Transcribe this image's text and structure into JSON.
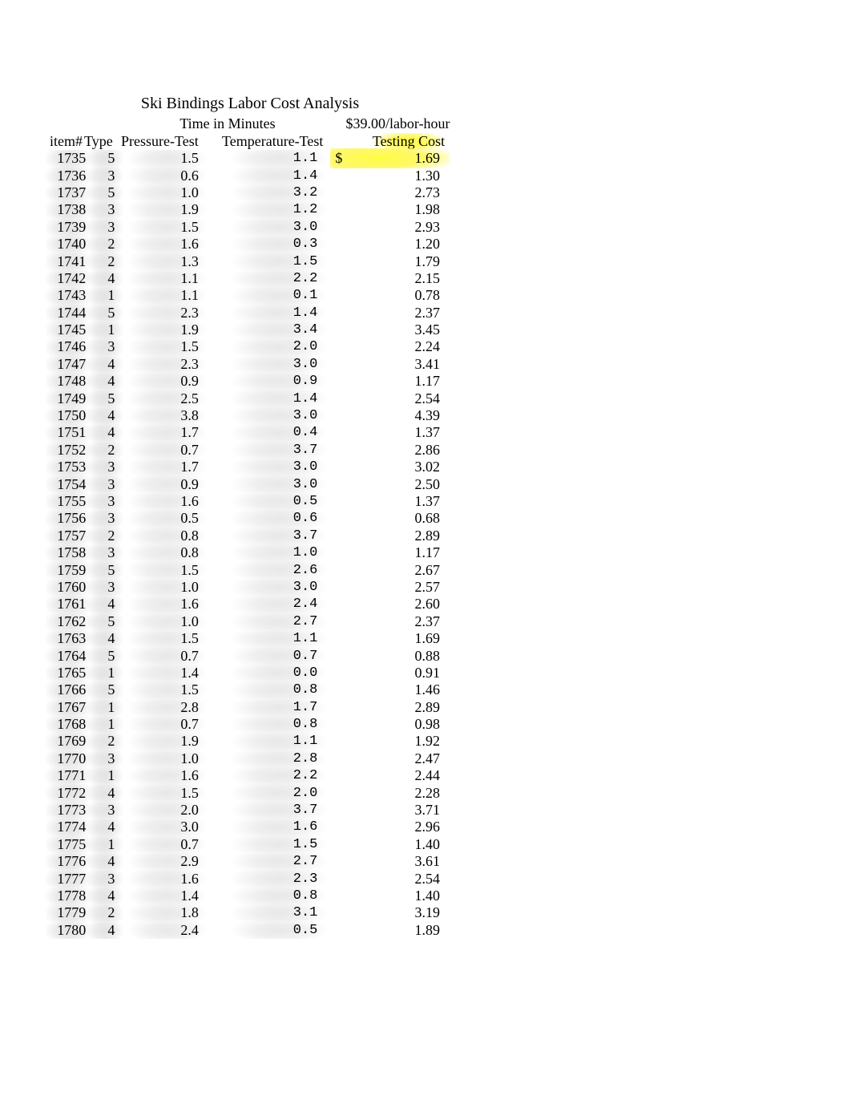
{
  "title": "Ski Bindings Labor Cost Analysis",
  "super_headers": {
    "time": "Time in Minutes",
    "rate": "$39.00/labor-hour"
  },
  "headers": {
    "item": "item#",
    "type": "Type",
    "pressure": "Pressure-Test",
    "temp": "Temperature-Test",
    "cost": "Testing Cost"
  },
  "currency_symbol": "$",
  "rows": [
    {
      "item": "1735",
      "type": "5",
      "pressure": "1.5",
      "temp": "1.1",
      "cost": "1.69"
    },
    {
      "item": "1736",
      "type": "3",
      "pressure": "0.6",
      "temp": "1.4",
      "cost": "1.30"
    },
    {
      "item": "1737",
      "type": "5",
      "pressure": "1.0",
      "temp": "3.2",
      "cost": "2.73"
    },
    {
      "item": "1738",
      "type": "3",
      "pressure": "1.9",
      "temp": "1.2",
      "cost": "1.98"
    },
    {
      "item": "1739",
      "type": "3",
      "pressure": "1.5",
      "temp": "3.0",
      "cost": "2.93"
    },
    {
      "item": "1740",
      "type": "2",
      "pressure": "1.6",
      "temp": "0.3",
      "cost": "1.20"
    },
    {
      "item": "1741",
      "type": "2",
      "pressure": "1.3",
      "temp": "1.5",
      "cost": "1.79"
    },
    {
      "item": "1742",
      "type": "4",
      "pressure": "1.1",
      "temp": "2.2",
      "cost": "2.15"
    },
    {
      "item": "1743",
      "type": "1",
      "pressure": "1.1",
      "temp": "0.1",
      "cost": "0.78"
    },
    {
      "item": "1744",
      "type": "5",
      "pressure": "2.3",
      "temp": "1.4",
      "cost": "2.37"
    },
    {
      "item": "1745",
      "type": "1",
      "pressure": "1.9",
      "temp": "3.4",
      "cost": "3.45"
    },
    {
      "item": "1746",
      "type": "3",
      "pressure": "1.5",
      "temp": "2.0",
      "cost": "2.24"
    },
    {
      "item": "1747",
      "type": "4",
      "pressure": "2.3",
      "temp": "3.0",
      "cost": "3.41"
    },
    {
      "item": "1748",
      "type": "4",
      "pressure": "0.9",
      "temp": "0.9",
      "cost": "1.17"
    },
    {
      "item": "1749",
      "type": "5",
      "pressure": "2.5",
      "temp": "1.4",
      "cost": "2.54"
    },
    {
      "item": "1750",
      "type": "4",
      "pressure": "3.8",
      "temp": "3.0",
      "cost": "4.39"
    },
    {
      "item": "1751",
      "type": "4",
      "pressure": "1.7",
      "temp": "0.4",
      "cost": "1.37"
    },
    {
      "item": "1752",
      "type": "2",
      "pressure": "0.7",
      "temp": "3.7",
      "cost": "2.86"
    },
    {
      "item": "1753",
      "type": "3",
      "pressure": "1.7",
      "temp": "3.0",
      "cost": "3.02"
    },
    {
      "item": "1754",
      "type": "3",
      "pressure": "0.9",
      "temp": "3.0",
      "cost": "2.50"
    },
    {
      "item": "1755",
      "type": "3",
      "pressure": "1.6",
      "temp": "0.5",
      "cost": "1.37"
    },
    {
      "item": "1756",
      "type": "3",
      "pressure": "0.5",
      "temp": "0.6",
      "cost": "0.68"
    },
    {
      "item": "1757",
      "type": "2",
      "pressure": "0.8",
      "temp": "3.7",
      "cost": "2.89"
    },
    {
      "item": "1758",
      "type": "3",
      "pressure": "0.8",
      "temp": "1.0",
      "cost": "1.17"
    },
    {
      "item": "1759",
      "type": "5",
      "pressure": "1.5",
      "temp": "2.6",
      "cost": "2.67"
    },
    {
      "item": "1760",
      "type": "3",
      "pressure": "1.0",
      "temp": "3.0",
      "cost": "2.57"
    },
    {
      "item": "1761",
      "type": "4",
      "pressure": "1.6",
      "temp": "2.4",
      "cost": "2.60"
    },
    {
      "item": "1762",
      "type": "5",
      "pressure": "1.0",
      "temp": "2.7",
      "cost": "2.37"
    },
    {
      "item": "1763",
      "type": "4",
      "pressure": "1.5",
      "temp": "1.1",
      "cost": "1.69"
    },
    {
      "item": "1764",
      "type": "5",
      "pressure": "0.7",
      "temp": "0.7",
      "cost": "0.88"
    },
    {
      "item": "1765",
      "type": "1",
      "pressure": "1.4",
      "temp": "0.0",
      "cost": "0.91"
    },
    {
      "item": "1766",
      "type": "5",
      "pressure": "1.5",
      "temp": "0.8",
      "cost": "1.46"
    },
    {
      "item": "1767",
      "type": "1",
      "pressure": "2.8",
      "temp": "1.7",
      "cost": "2.89"
    },
    {
      "item": "1768",
      "type": "1",
      "pressure": "0.7",
      "temp": "0.8",
      "cost": "0.98"
    },
    {
      "item": "1769",
      "type": "2",
      "pressure": "1.9",
      "temp": "1.1",
      "cost": "1.92"
    },
    {
      "item": "1770",
      "type": "3",
      "pressure": "1.0",
      "temp": "2.8",
      "cost": "2.47"
    },
    {
      "item": "1771",
      "type": "1",
      "pressure": "1.6",
      "temp": "2.2",
      "cost": "2.44"
    },
    {
      "item": "1772",
      "type": "4",
      "pressure": "1.5",
      "temp": "2.0",
      "cost": "2.28"
    },
    {
      "item": "1773",
      "type": "3",
      "pressure": "2.0",
      "temp": "3.7",
      "cost": "3.71"
    },
    {
      "item": "1774",
      "type": "4",
      "pressure": "3.0",
      "temp": "1.6",
      "cost": "2.96"
    },
    {
      "item": "1775",
      "type": "1",
      "pressure": "0.7",
      "temp": "1.5",
      "cost": "1.40"
    },
    {
      "item": "1776",
      "type": "4",
      "pressure": "2.9",
      "temp": "2.7",
      "cost": "3.61"
    },
    {
      "item": "1777",
      "type": "3",
      "pressure": "1.6",
      "temp": "2.3",
      "cost": "2.54"
    },
    {
      "item": "1778",
      "type": "4",
      "pressure": "1.4",
      "temp": "0.8",
      "cost": "1.40"
    },
    {
      "item": "1779",
      "type": "2",
      "pressure": "1.8",
      "temp": "3.1",
      "cost": "3.19"
    },
    {
      "item": "1780",
      "type": "4",
      "pressure": "2.4",
      "temp": "0.5",
      "cost": "1.89"
    }
  ]
}
